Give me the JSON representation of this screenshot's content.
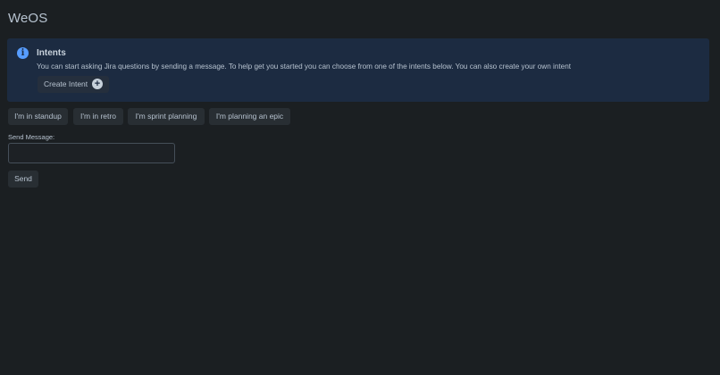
{
  "app": {
    "title": "WeOS"
  },
  "banner": {
    "title": "Intents",
    "text": "You can start asking Jira questions by sending a message. To help get you started you can choose from one of the intents below. You can also create your own intent",
    "create_button": "Create Intent",
    "info_icon": "info-icon",
    "add_icon": "plus-circle-icon"
  },
  "intents": [
    {
      "label": "I'm in standup"
    },
    {
      "label": "I'm in retro"
    },
    {
      "label": "I'm sprint planning"
    },
    {
      "label": "I'm planning an epic"
    }
  ],
  "message": {
    "label": "Send Message:",
    "value": "",
    "placeholder": "",
    "send_button": "Send"
  },
  "colors": {
    "background": "#1b1f22",
    "banner_background": "#1c2b41",
    "info_accent": "#579dff",
    "button_background": "#282e33",
    "text": "#b6c2cf"
  }
}
